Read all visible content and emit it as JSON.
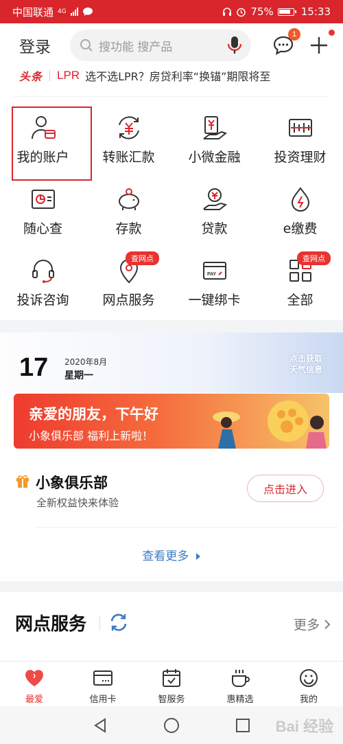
{
  "status_bar": {
    "carrier": "中国联通",
    "network": "4G",
    "battery": "75%",
    "time": "15:33"
  },
  "header": {
    "login_label": "登录",
    "search_placeholder": "搜功能 搜产品",
    "message_badge": "1"
  },
  "headline": {
    "tag": "头条",
    "keyword": "LPR",
    "text": "选不选LPR？房贷利率“换锚”期限将至"
  },
  "grid": [
    {
      "label": "我的账户",
      "icon": "account-icon"
    },
    {
      "label": "转账汇款",
      "icon": "transfer-icon"
    },
    {
      "label": "小微金融",
      "icon": "micro-finance-icon"
    },
    {
      "label": "投资理财",
      "icon": "investment-icon"
    },
    {
      "label": "随心查",
      "icon": "query-icon"
    },
    {
      "label": "存款",
      "icon": "piggy-bank-icon"
    },
    {
      "label": "贷款",
      "icon": "loan-icon"
    },
    {
      "label": "e缴费",
      "icon": "payment-icon"
    },
    {
      "label": "投诉咨询",
      "icon": "headset-icon"
    },
    {
      "label": "网点服务",
      "icon": "location-icon",
      "tag": "查网点"
    },
    {
      "label": "一键绑卡",
      "icon": "pay-card-icon"
    },
    {
      "label": "全部",
      "icon": "all-apps-icon",
      "tag": "查网点"
    }
  ],
  "date_card": {
    "day": "17",
    "year_month": "2020年8月",
    "weekday": "星期一",
    "weather_line1": "点击获取",
    "weather_line2": "天气信息"
  },
  "banner": {
    "title": "亲爱的朋友，下午好",
    "subtitle": "小象俱乐部 福利上新啦！"
  },
  "club": {
    "title": "小象俱乐部",
    "subtitle": "全新权益快来体验",
    "button": "点击进入"
  },
  "more_link": "查看更多",
  "branch_section": {
    "title": "网点服务",
    "more": "更多"
  },
  "tabs": [
    {
      "label": "最爱",
      "icon": "heart-icon",
      "active": true
    },
    {
      "label": "信用卡",
      "icon": "credit-card-icon"
    },
    {
      "label": "智服务",
      "icon": "calendar-check-icon"
    },
    {
      "label": "惠精选",
      "icon": "cup-icon"
    },
    {
      "label": "我的",
      "icon": "smile-icon"
    }
  ],
  "watermark": "Bai 经验",
  "colors": {
    "brand_red": "#d8262c",
    "link_blue": "#3e7bc4"
  }
}
